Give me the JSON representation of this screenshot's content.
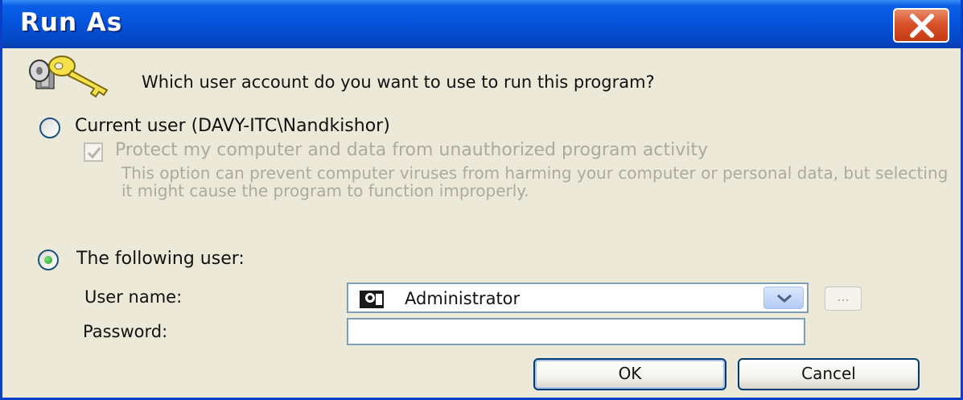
{
  "window": {
    "title": "Run As"
  },
  "prompt": {
    "question": "Which user account do you want to use to run this program?"
  },
  "current_user": {
    "label": "Current user (DAVY-ITC\\Nandkishor)",
    "selected": false,
    "protect_label": "Protect my computer and data from unauthorized program activity",
    "protect_checked": true,
    "protect_enabled": false,
    "description": "This option can prevent computer viruses from harming your computer or personal data, but selecting it might cause the program to function improperly."
  },
  "following_user": {
    "label": "The following user:",
    "selected": true,
    "username_label": "User name:",
    "username_value": "Administrator",
    "browse_label": "...",
    "password_label": "Password:",
    "password_value": ""
  },
  "buttons": {
    "ok": "OK",
    "cancel": "Cancel"
  },
  "icons": {
    "title_close": "close-icon",
    "header": "key-icon",
    "user": "user-icon",
    "dropdown": "chevron-down-icon"
  },
  "colors": {
    "titlebar": "#0454dc",
    "close_button": "#d8522a",
    "dialog_background": "#ece9d8",
    "disabled_text": "#adaa9c"
  }
}
